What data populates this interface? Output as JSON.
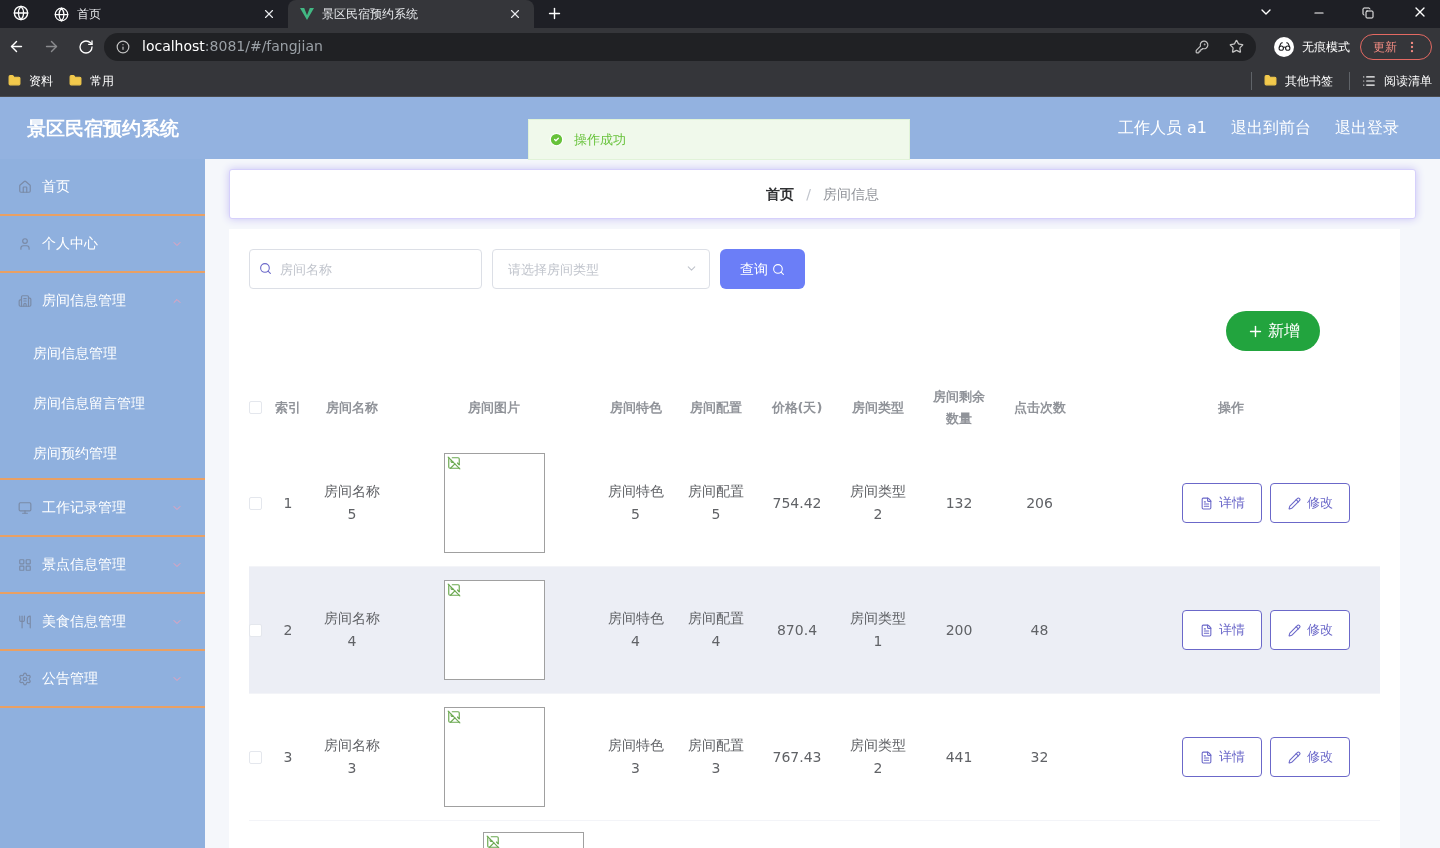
{
  "browser": {
    "tabs": [
      {
        "title": "首页",
        "selected": false
      },
      {
        "title": "景区民宿预约系统",
        "selected": true
      }
    ],
    "url_host": "localhost",
    "url_path": ":8081/#/fangjian",
    "profile": "无痕模式",
    "update_button": "更新",
    "bookmarks": [
      "资料",
      "常用"
    ],
    "bookmarks_right": [
      "其他书签",
      "阅读清单"
    ]
  },
  "header": {
    "title": "景区民宿预约系统",
    "links": [
      "工作人员 a1",
      "退出到前台",
      "退出登录"
    ]
  },
  "toast": {
    "message": "操作成功"
  },
  "sidebar": {
    "items": [
      {
        "label": "首页"
      },
      {
        "label": "个人中心",
        "expanded": false
      },
      {
        "label": "房间信息管理",
        "expanded": true,
        "children": [
          {
            "label": "房间信息管理"
          },
          {
            "label": "房间信息留言管理"
          },
          {
            "label": "房间预约管理"
          }
        ]
      },
      {
        "label": "工作记录管理",
        "expanded": false
      },
      {
        "label": "景点信息管理",
        "expanded": false
      },
      {
        "label": "美食信息管理",
        "expanded": false
      },
      {
        "label": "公告管理",
        "expanded": false
      }
    ]
  },
  "breadcrumb": [
    "首页",
    "房间信息"
  ],
  "breadcrumb_separator": "/",
  "filters": {
    "name_placeholder": "房间名称",
    "type_placeholder": "请选择房间类型",
    "query_button": "查询"
  },
  "add_button": "新增",
  "table": {
    "select_all_checked": false,
    "columns": [
      "索引",
      "房间名称",
      "房间图片",
      "房间特色",
      "房间配置",
      "价格(天)",
      "房间类型",
      "房间剩余数量",
      "点击次数",
      "操作"
    ],
    "rows": [
      {
        "index": "1",
        "name": "房间名称5",
        "feature": "房间特色5",
        "config": "房间配置5",
        "price": "754.42",
        "type": "房间类型2",
        "remaining": "132",
        "clicks": "206",
        "checked": false,
        "hovered": false,
        "actions": [
          "详情",
          "修改"
        ]
      },
      {
        "index": "2",
        "name": "房间名称4",
        "feature": "房间特色4",
        "config": "房间配置4",
        "price": "870.4",
        "type": "房间类型1",
        "remaining": "200",
        "clicks": "48",
        "checked": false,
        "hovered": true,
        "actions": [
          "详情",
          "修改"
        ]
      },
      {
        "index": "3",
        "name": "房间名称3",
        "feature": "房间特色3",
        "config": "房间配置3",
        "price": "767.43",
        "type": "房间类型2",
        "remaining": "441",
        "clicks": "32",
        "checked": false,
        "hovered": false,
        "actions": [
          "详情",
          "修改"
        ]
      }
    ],
    "more_rows_below": true
  }
}
